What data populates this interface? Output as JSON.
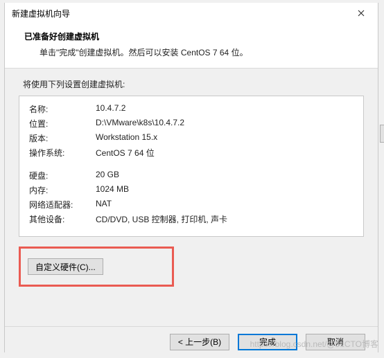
{
  "titlebar": {
    "title": "新建虚拟机向导"
  },
  "header": {
    "title": "已准备好创建虚拟机",
    "subtitle": "单击\"完成\"创建虚拟机。然后可以安装 CentOS 7 64 位。"
  },
  "body": {
    "label": "将使用下列设置创建虚拟机:",
    "rows1": [
      {
        "key": "名称:",
        "val": "10.4.7.2"
      },
      {
        "key": "位置:",
        "val": "D:\\VMware\\k8s\\10.4.7.2"
      },
      {
        "key": "版本:",
        "val": "Workstation 15.x"
      },
      {
        "key": "操作系统:",
        "val": "CentOS 7 64 位"
      }
    ],
    "rows2": [
      {
        "key": "硬盘:",
        "val": "20 GB"
      },
      {
        "key": "内存:",
        "val": "1024 MB"
      },
      {
        "key": "网络适配器:",
        "val": "NAT"
      },
      {
        "key": "其他设备:",
        "val": "CD/DVD, USB 控制器, 打印机, 声卡"
      }
    ],
    "customize_label": "自定义硬件(C)..."
  },
  "footer": {
    "back": "< 上一步(B)",
    "finish": "完成",
    "cancel": "取消"
  },
  "watermark": "https://blog.csdn.net/@51CTO博客"
}
